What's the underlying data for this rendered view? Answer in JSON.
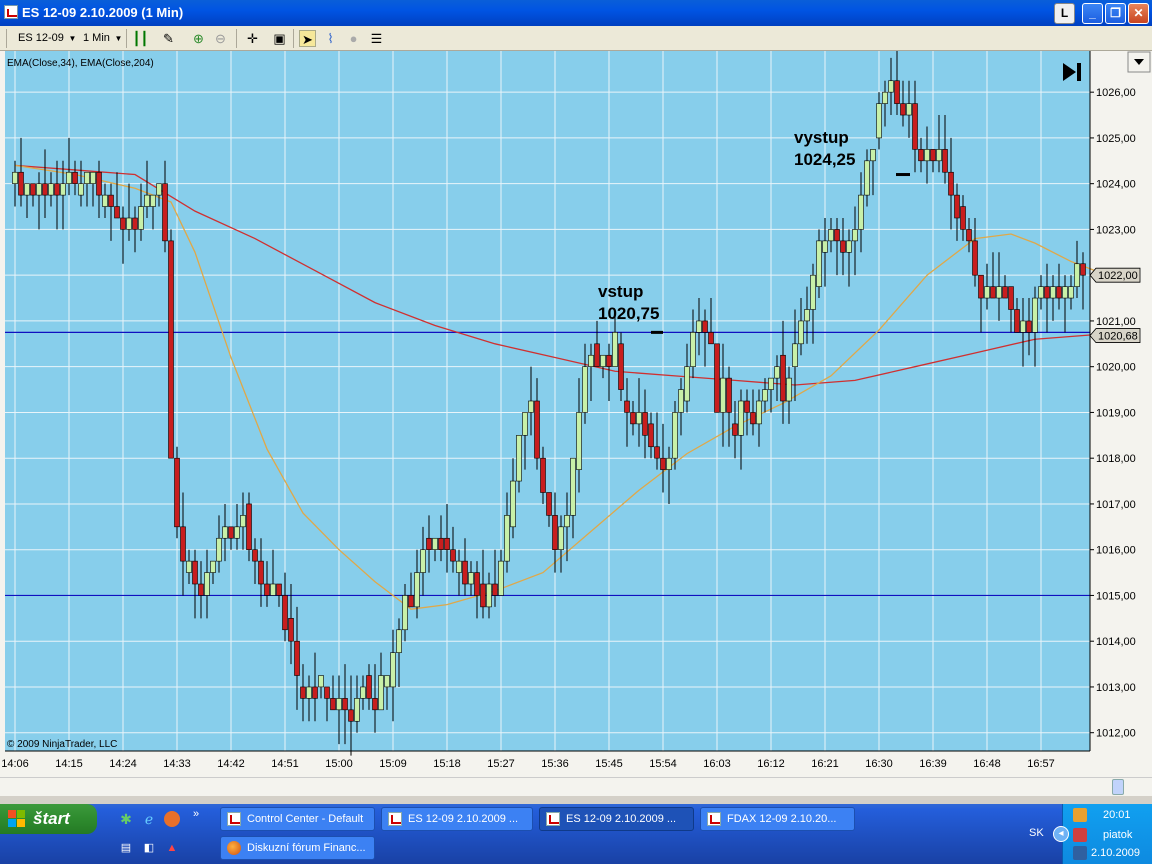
{
  "window": {
    "title": "ES 12-09  2.10.2009 (1 Min)",
    "btn_l": "L",
    "btn_min": "_",
    "btn_max": "❐",
    "btn_close": "✕"
  },
  "toolbar": {
    "instrument": "ES 12-09",
    "interval": "1 Min"
  },
  "chart": {
    "indicator_label": "EMA(Close,34), EMA(Close,204)",
    "copyright": "© 2009 NinjaTrader, LLC",
    "annotations": [
      {
        "line1": "vstup",
        "line2": "1020,75"
      },
      {
        "line1": "vystup",
        "line2": "1024,25"
      }
    ],
    "price_markers": [
      {
        "label": "1022,00",
        "value": 1022.0
      },
      {
        "label": "1020,68",
        "value": 1020.68
      }
    ],
    "horizontal_lines": [
      1020.75,
      1015.0
    ],
    "grid": true,
    "colors": {
      "background": "#87ceeb",
      "up": "#c8f0a8",
      "down": "#c81e1e",
      "ema34": "#e0a848",
      "ema204": "#d03030",
      "hline": "#1010c0"
    }
  },
  "chart_data": {
    "type": "candlestick",
    "y_ticks": [
      "1026,00",
      "1025,00",
      "1024,00",
      "1023,00",
      "1022,00",
      "1021,00",
      "1020,00",
      "1019,00",
      "1018,00",
      "1017,00",
      "1016,00",
      "1015,00",
      "1014,00",
      "1013,00",
      "1012,00"
    ],
    "y_tick_values": [
      1026,
      1025,
      1024,
      1023,
      1022,
      1021,
      1020,
      1019,
      1018,
      1017,
      1016,
      1015,
      1014,
      1013,
      1012
    ],
    "ylim": [
      1011.6,
      1026.9
    ],
    "x_ticks": [
      "14:06",
      "14:15",
      "14:24",
      "14:33",
      "14:42",
      "14:51",
      "15:00",
      "15:09",
      "15:18",
      "15:27",
      "15:36",
      "15:45",
      "15:54",
      "16:03",
      "16:12",
      "16:21",
      "16:30",
      "16:39",
      "16:48",
      "16:57"
    ],
    "x_tick_minutes": [
      0,
      9,
      18,
      27,
      36,
      45,
      54,
      63,
      72,
      81,
      90,
      99,
      108,
      117,
      126,
      135,
      144,
      153,
      162,
      171
    ],
    "close_path_minutes": [
      0,
      4,
      8,
      12,
      16,
      18,
      20,
      22,
      24,
      25,
      26,
      27,
      28,
      30,
      32,
      34,
      36,
      38,
      40,
      42,
      44,
      46,
      48,
      50,
      52,
      54,
      56,
      58,
      60,
      62,
      64,
      66,
      68,
      70,
      72,
      74,
      76,
      78,
      80,
      82,
      84,
      86,
      88,
      90,
      92,
      94,
      96,
      98,
      100,
      102,
      104,
      106,
      108,
      110,
      112,
      114,
      116,
      117,
      118,
      120,
      122,
      124,
      126,
      128,
      130,
      132,
      134,
      136,
      138,
      140,
      142,
      144,
      146,
      148,
      150,
      152,
      154,
      156,
      158,
      160,
      162,
      164,
      166,
      168,
      170,
      172,
      174,
      176,
      178,
      180
    ],
    "close_path_values": [
      1024.0,
      1023.9,
      1023.9,
      1023.9,
      1023.5,
      1023.0,
      1023.2,
      1023.8,
      1024.1,
      1022.8,
      1018.2,
      1016.8,
      1015.8,
      1015.2,
      1015.6,
      1016.2,
      1016.0,
      1016.3,
      1015.5,
      1015.3,
      1014.9,
      1014.0,
      1013.0,
      1013.2,
      1012.7,
      1012.5,
      1012.4,
      1013.3,
      1012.8,
      1013.5,
      1014.6,
      1015.2,
      1016.0,
      1016.1,
      1016.3,
      1015.8,
      1015.3,
      1015.0,
      1015.4,
      1016.8,
      1018.6,
      1019.3,
      1017.0,
      1016.1,
      1016.7,
      1018.8,
      1020.5,
      1020.1,
      1020.5,
      1019.2,
      1018.8,
      1018.3,
      1017.5,
      1019.0,
      1020.4,
      1021.1,
      1020.2,
      1019.0,
      1019.4,
      1018.7,
      1019.3,
      1019.0,
      1020.0,
      1019.3,
      1020.4,
      1021.5,
      1022.5,
      1022.9,
      1022.7,
      1022.9,
      1024.2,
      1025.5,
      1026.0,
      1025.5,
      1025.0,
      1024.6,
      1024.3,
      1023.7,
      1023.1,
      1022.0,
      1021.7,
      1021.8,
      1021.0,
      1020.7,
      1021.3,
      1021.6,
      1021.3,
      1021.9,
      1022.1,
      1022.0
    ],
    "ema34_minutes": [
      0,
      10,
      20,
      26,
      30,
      36,
      42,
      48,
      54,
      60,
      66,
      72,
      80,
      88,
      96,
      104,
      112,
      120,
      128,
      136,
      144,
      152,
      160,
      166,
      170,
      176,
      180
    ],
    "ema34_values": [
      1024.4,
      1024.2,
      1023.9,
      1023.6,
      1022.5,
      1020.2,
      1018.2,
      1016.8,
      1016.0,
      1015.3,
      1014.7,
      1014.8,
      1015.1,
      1015.5,
      1016.4,
      1017.3,
      1018.1,
      1018.7,
      1019.2,
      1019.8,
      1020.8,
      1022.0,
      1022.8,
      1022.9,
      1022.7,
      1022.3,
      1022.1
    ],
    "ema204_minutes": [
      0,
      10,
      20,
      30,
      40,
      50,
      60,
      70,
      80,
      90,
      100,
      110,
      120,
      130,
      140,
      150,
      160,
      170,
      180
    ],
    "ema204_values": [
      1024.4,
      1024.3,
      1024.2,
      1023.4,
      1022.8,
      1022.1,
      1021.4,
      1020.9,
      1020.5,
      1020.2,
      1019.9,
      1019.8,
      1019.7,
      1019.6,
      1019.7,
      1020.0,
      1020.3,
      1020.6,
      1020.7
    ]
  },
  "taskbar": {
    "start_label": "štart",
    "tasks": [
      {
        "label": "Control Center - Default"
      },
      {
        "label": "ES 12-09  2.10.2009 ..."
      },
      {
        "label": "ES 12-09  2.10.2009 ..."
      },
      {
        "label": "FDAX 12-09  2.10.20..."
      },
      {
        "label": "Diskuzní fórum Financ..."
      }
    ],
    "expand": "»",
    "tray": {
      "lang": "SK",
      "time": "20:01",
      "day": "piatok",
      "date": "2.10.2009"
    }
  }
}
